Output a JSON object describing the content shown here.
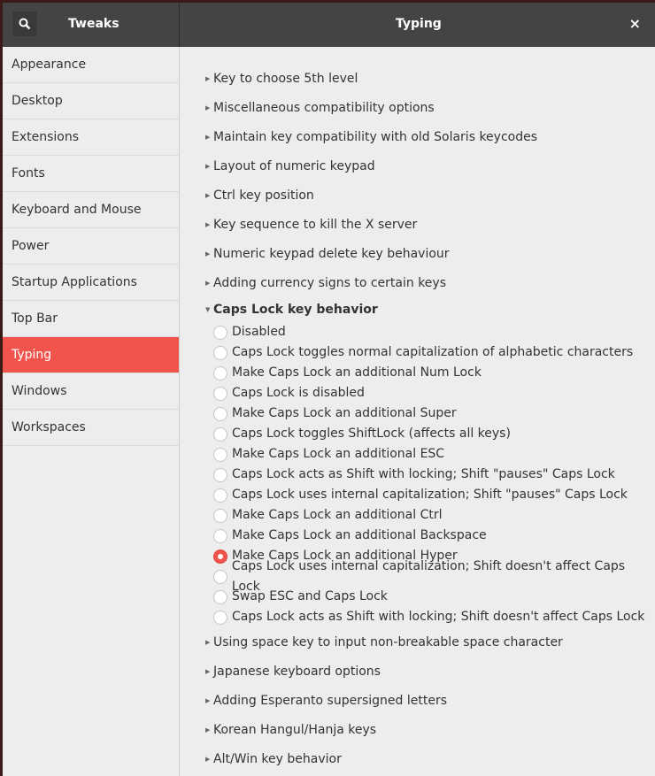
{
  "header": {
    "app_title": "Tweaks",
    "page_title": "Typing",
    "close_label": "×"
  },
  "sidebar": {
    "items": [
      "Appearance",
      "Desktop",
      "Extensions",
      "Fonts",
      "Keyboard and Mouse",
      "Power",
      "Startup Applications",
      "Top Bar",
      "Typing",
      "Windows",
      "Workspaces"
    ],
    "selected": "Typing"
  },
  "accent": "#f0544c",
  "sections_before": [
    "Key to choose 5th level",
    "Miscellaneous compatibility options",
    "Maintain key compatibility with old Solaris keycodes",
    "Layout of numeric keypad",
    "Ctrl key position",
    "Key sequence to kill the X server",
    "Numeric keypad delete key behaviour",
    "Adding currency signs to certain keys"
  ],
  "expanded": {
    "title": "Caps Lock key behavior",
    "options": [
      "Disabled",
      "Caps Lock toggles normal capitalization of alphabetic characters",
      "Make Caps Lock an additional Num Lock",
      "Caps Lock is disabled",
      "Make Caps Lock an additional Super",
      "Caps Lock toggles ShiftLock (affects all keys)",
      "Make Caps Lock an additional ESC",
      "Caps Lock acts as Shift with locking; Shift \"pauses\" Caps Lock",
      "Caps Lock uses internal capitalization; Shift \"pauses\" Caps Lock",
      "Make Caps Lock an additional Ctrl",
      "Make Caps Lock an additional Backspace",
      "Make Caps Lock an additional Hyper",
      "Caps Lock uses internal capitalization; Shift doesn't affect Caps Lock",
      "Swap ESC and Caps Lock",
      "Caps Lock acts as Shift with locking; Shift doesn't affect Caps Lock"
    ],
    "selected": "Make Caps Lock an additional Hyper"
  },
  "sections_after": [
    "Using space key to input non-breakable space character",
    "Japanese keyboard options",
    "Adding Esperanto supersigned letters",
    "Korean Hangul/Hanja keys",
    "Alt/Win key behavior"
  ]
}
